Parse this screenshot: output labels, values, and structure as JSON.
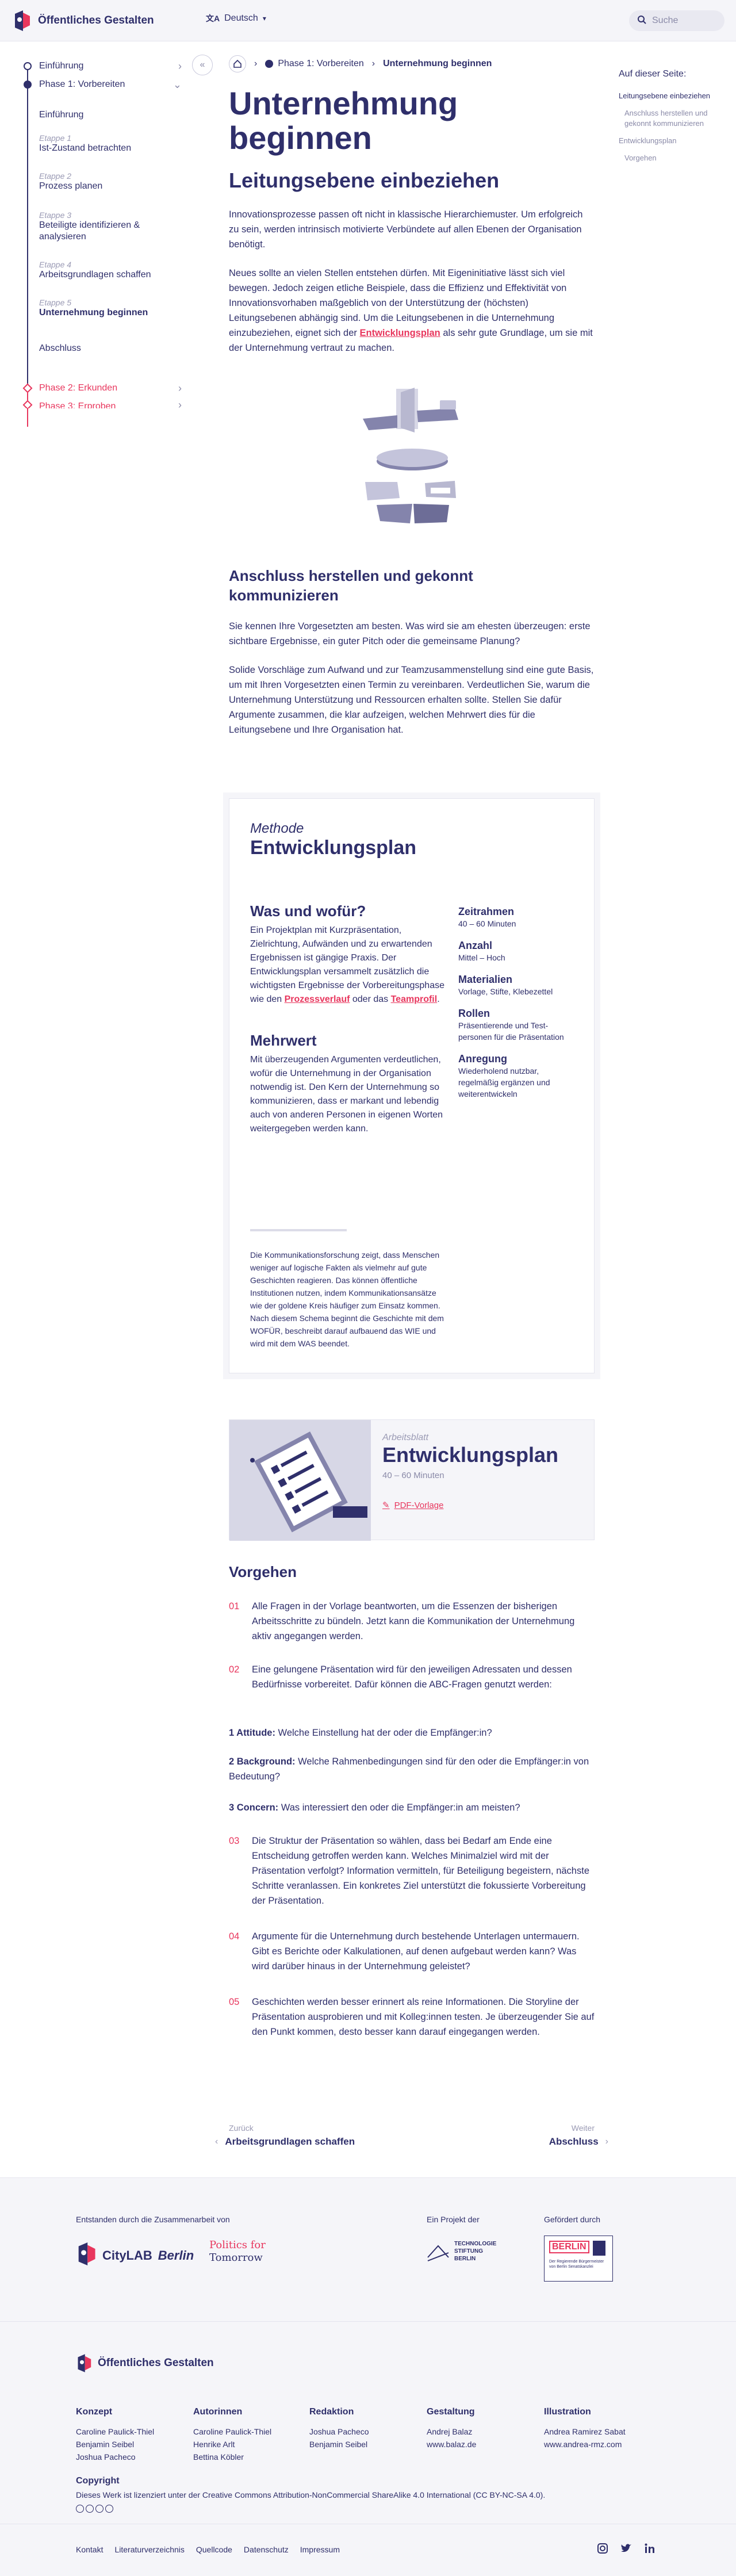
{
  "header": {
    "site_title": "Öffentliches Gestalten",
    "language": "Deutsch",
    "search_placeholder": "Suche"
  },
  "sidebar": {
    "items": [
      {
        "label": "Einführung"
      },
      {
        "label": "Phase 1: Vorbereiten"
      },
      {
        "label": "Einführung"
      },
      {
        "stage": "Etappe 1",
        "label": "Ist-Zustand betrachten"
      },
      {
        "stage": "Etappe 2",
        "label": "Prozess planen"
      },
      {
        "stage": "Etappe 3",
        "label": "Beteiligte identifizieren & analysieren"
      },
      {
        "stage": "Etappe 4",
        "label": "Arbeitsgrundlagen schaffen"
      },
      {
        "stage": "Etappe 5",
        "label": "Unternehmung beginnen"
      },
      {
        "label": "Abschluss"
      },
      {
        "label": "Phase 2: Erkunden"
      },
      {
        "label": "Phase 3: Erproben"
      }
    ]
  },
  "breadcrumb": {
    "phase": "Phase 1: Vorbereiten",
    "current": "Unternehmung beginnen"
  },
  "toc": {
    "title": "Auf dieser Seite:",
    "items": [
      "Leitungsebene einbeziehen",
      "Anschluss herstellen und gekonnt kommunizieren",
      "Entwicklungsplan",
      "Vorgehen"
    ]
  },
  "main": {
    "title": "Unternehmung beginnen",
    "section1": {
      "heading": "Leitungsebene einbeziehen",
      "p1": "Innovationsprozesse passen oft nicht in klassische Hierarchiemuster. Um erfolgreich zu sein, werden intrinsisch motivierte Verbündete auf allen Ebenen der Organisation benötigt.",
      "p2_pre": "Neues sollte an vielen Stellen entstehen dürfen. Mit Eigeninitiative lässt sich viel bewegen. Jedoch zeigen etliche Beispiele, dass die Effizienz und Effektivität von Innovationsvorhaben maßgeblich von der Unterstützung der (höchsten) Leitungsebenen abhängig sind. Um die Leitungsebenen in die Unternehmung einzubeziehen, eignet sich der ",
      "p2_link": "Entwicklungsplan",
      "p2_post": " als sehr gute Grundlage, um sie mit der Unternehmung vertraut zu machen."
    },
    "section2": {
      "heading": "Anschluss herstellen und gekonnt kommunizieren",
      "p1": "Sie kennen Ihre Vorgesetzten am besten. Was wird sie am ehesten überzeugen: erste sichtbare Ergebnisse, ein guter Pitch oder die gemeinsame Planung?",
      "p2": "Solide Vorschläge zum Aufwand und zur Teamzusammenstellung sind eine gute Basis, um mit Ihren Vorgesetzten einen Termin zu vereinbaren. Verdeutlichen Sie, warum die Unternehmung Unterstützung und Ressourcen erhalten sollte. Stellen Sie dafür Argumente zusammen, die klar aufzeigen, welchen Mehrwert dies für die Leitungsebene und Ihre Organisation hat."
    }
  },
  "method": {
    "kicker": "Methode",
    "title": "Entwicklungsplan",
    "what_heading": "Was und wofür?",
    "what_pre": "Ein Projektplan mit Kurzpräsentation, Zielrichtung, Aufwänden und zu erwartenden Ergebnissen ist gängige Praxis. Der Entwicklungsplan versammelt zusätzlich die wichtigsten Ergebnisse der Vorbereitungsphase wie den ",
    "what_link1": "Prozessverlauf",
    "what_mid": " oder das ",
    "what_link2": "Teamprofil",
    "what_post": ".",
    "value_heading": "Mehrwert",
    "value_text": "Mit überzeugenden Argumenten verdeutlichen, wofür die Unternehmung in der Organisation notwendig ist. Den Kern der Unternehmung so kommunizieren, dass er markant und lebendig auch von anderen Personen in eigenen Worten weitergegeben werden kann.",
    "meta": [
      {
        "label": "Zeitrahmen",
        "value": "40 – 60 Minuten"
      },
      {
        "label": "Anzahl",
        "value": "Mittel – Hoch"
      },
      {
        "label": "Materialien",
        "value": "Vorlage, Stifte, Klebezettel"
      },
      {
        "label": "Rollen",
        "value": "Präsentierende und Test­personen für die Präsentation"
      },
      {
        "label": "Anregung",
        "value": "Wiederholend nutzbar, regelmäßig ergänzen und weiterentwickeln"
      }
    ],
    "quote": "Die Kommunikationsforschung zeigt, dass Menschen weniger auf logische Fakten als vielmehr auf gute Geschichten reagieren. Das können öffentliche Institutionen nutzen, indem Kommunikationsansätze wie der goldene Kreis häufiger zum Einsatz kommen. Nach diesem Schema beginnt die Geschichte mit dem WOFÜR, beschreibt darauf aufbauend das WIE und wird mit dem WAS beendet."
  },
  "worksheet": {
    "kicker": "Arbeitsblatt",
    "title": "Entwicklungsplan",
    "duration": "40 – 60 Minuten",
    "link": "PDF-Vorlage"
  },
  "procedure": {
    "heading": "Vorgehen",
    "steps": [
      {
        "num": "01",
        "text": "Alle Fragen in der Vorlage beantworten, um die Essenzen der bisherigen Arbeitsschritte zu bündeln. Jetzt kann die Kommunikation der Unternehmung aktiv angegangen werden."
      },
      {
        "num": "02",
        "text": "Eine gelungene Präsentation wird für den jeweiligen Adressaten und dessen Bedürfnisse vorbereitet. Dafür können die ABC-Fragen genutzt werden:"
      },
      {
        "num": "03",
        "text": "Die Struktur der Präsentation so wählen, dass bei Bedarf am Ende eine Entscheidung getroffen werden kann. Welches Minimalziel wird mit der Präsentation verfolgt? Information vermitteln, für Beteiligung begeistern, nächste Schritte veranlassen. Ein konkretes Ziel unterstützt die fokussierte Vorbereitung der Präsentation."
      },
      {
        "num": "04",
        "text": "Argumente für die Unternehmung durch bestehende Unterlagen untermauern. Gibt es Berichte oder Kalkulationen, auf denen aufgebaut werden kann? Was wird darüber hinaus in der Unternehmung geleistet?"
      },
      {
        "num": "05",
        "text": "Geschichten werden besser erinnert als reine Informationen. Die Storyline der Präsentation ausprobieren und mit Kolleg:innen testen. Je überzeugender Sie auf den Punkt kommen, desto besser kann darauf eingegangen werden."
      }
    ],
    "abc": [
      {
        "label": "1 Attitude:",
        "text": " Welche Einstellung hat der oder die Empfänger:in?"
      },
      {
        "label": "2 Background:",
        "text": " Welche Rahmenbedingungen sind für den oder die Empfänger:in von Bedeutung?"
      },
      {
        "label": "3 Concern:",
        "text": " Was interessiert den oder die Empfänger:in am meisten?"
      }
    ]
  },
  "pager": {
    "prev_small": "Zurück",
    "prev_label": "Arbeitsgrundlagen schaffen",
    "next_small": "Weiter",
    "next_label": "Abschluss"
  },
  "footer": {
    "collab_label": "Entstanden durch die Zusammenarbeit von",
    "citylab": "CityLAB",
    "citylab_city": "Berlin",
    "pft_line1": "Politics for",
    "pft_line2": "Tomorrow",
    "project_label": "Ein Projekt der",
    "tsb_line1": "TECHNOLOGIE",
    "tsb_line2": "STIFTUNG",
    "tsb_line3": "BERLIN",
    "funded_label": "Gefördert durch",
    "berlin": "BERLIN",
    "berlin_sub": "Der Regierende Bürgermeister von Berlin Senatskanzlei",
    "columns": [
      {
        "head": "Konzept",
        "names": [
          "Caroline Paulick-Thiel",
          "Benjamin Seibel",
          "Joshua Pacheco"
        ]
      },
      {
        "head": "Autorinnen",
        "names": [
          "Caroline Paulick-Thiel",
          "Henrike Arlt",
          "Bettina Köbler"
        ]
      },
      {
        "head": "Redaktion",
        "names": [
          "Joshua Pacheco",
          "Benjamin Seibel"
        ]
      },
      {
        "head": "Gestaltung",
        "names": [
          "Andrej Balaz",
          "www.balaz.de"
        ]
      },
      {
        "head": "Illustration",
        "names": [
          "Andrea Ramirez Sabat",
          "www.andrea-rmz.com"
        ]
      }
    ],
    "copyright_head": "Copyright",
    "copyright_text": "Dieses Werk ist lizenziert unter der Creative Commons Attribution-NonCommercial ShareAlike 4.0 International (CC BY-NC-SA 4.0).",
    "links": [
      "Kontakt",
      "Literaturverzeichnis",
      "Quellcode",
      "Datenschutz",
      "Impressum"
    ],
    "colors": {
      "navy": "#2f2f6b",
      "red": "#e8365d",
      "bg": "#f5f5f9"
    }
  }
}
